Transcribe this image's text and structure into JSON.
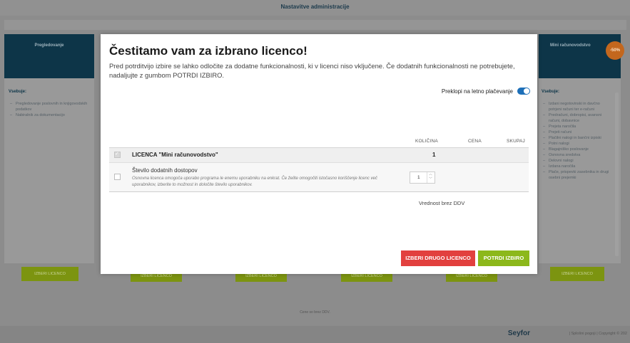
{
  "background": {
    "page_title": "Nastavitve administracije",
    "left_card": {
      "title": "Pregledovanje",
      "section_label": "Vsebuje:",
      "items": [
        "Pregledovanje poslovnih in knjigovodskih podatkov",
        "Nabiralnik za dokumentacijo"
      ],
      "button": "IZBERI LICENCO"
    },
    "right_card": {
      "title": "Mini računovodstvo",
      "badge": "-50%",
      "section_label": "Vsebuje:",
      "items": [
        "Izdani negotovinski in davčno potrjeni računi ter e-računi",
        "Predračuni, dobropisi, avansni računi, dobavnice",
        "Prejeta naročila",
        "Prejeti računi",
        "Plačilni nalogi in bančni izpiski",
        "Potni nalogi",
        "Blagajniško poslovanje",
        "Osnovna sredstva",
        "Delovni nalogi",
        "Izdana naročila",
        "Plače, prispevki zasebnika in drugi osebni prejemki"
      ],
      "button": "IZBERI LICENCO"
    },
    "hidden_buttons": [
      "IZBERI LICENCO",
      "IZBERI LICENCO",
      "IZBERI LICENCO",
      "IZBERI LICENCO"
    ],
    "footer_note": "Cene so brez DDV.",
    "brand": "Seyfor",
    "brand_links": "| Splošni pogoji | Copyright © 202"
  },
  "modal": {
    "title": "Čestitamo vam za izbrano licenco!",
    "description": "Pred potrditvijo izbire se lahko odločite za dodatne funkcionalnosti, ki v licenci niso vključene. Če dodatnih funkcionalnosti ne potrebujete, nadaljujte z gumbom POTRDI IZBIRO.",
    "toggle": {
      "label": "Preklopi na letno plačevanje",
      "on": true
    },
    "table": {
      "headers": {
        "quantity": "KOLIČINA",
        "price": "CENA",
        "total": "SKUPAJ"
      },
      "license_row": {
        "name": "LICENCA \"Mini računovodstvo\"",
        "quantity": "1",
        "checked": true
      },
      "extra_row": {
        "title": "Število dodatnih dostopov",
        "description": "Osnovna licenca omogoča uporabo programa le enemu uporabniku na enkrat. Če želite omogočiti istočasno koriščenje licenc več uporabnikov, izberite to možnost in določite število uporabnikov.",
        "quantity": "1",
        "checked": false
      }
    },
    "vat_note": "Vrednost brez DDV",
    "buttons": {
      "choose_other": "IZBERI DRUGO LICENCO",
      "confirm": "POTRDI IZBIRO"
    },
    "colors": {
      "danger": "#e2403e",
      "confirm": "#8cb81b",
      "toggle": "#1d6fb8"
    }
  }
}
